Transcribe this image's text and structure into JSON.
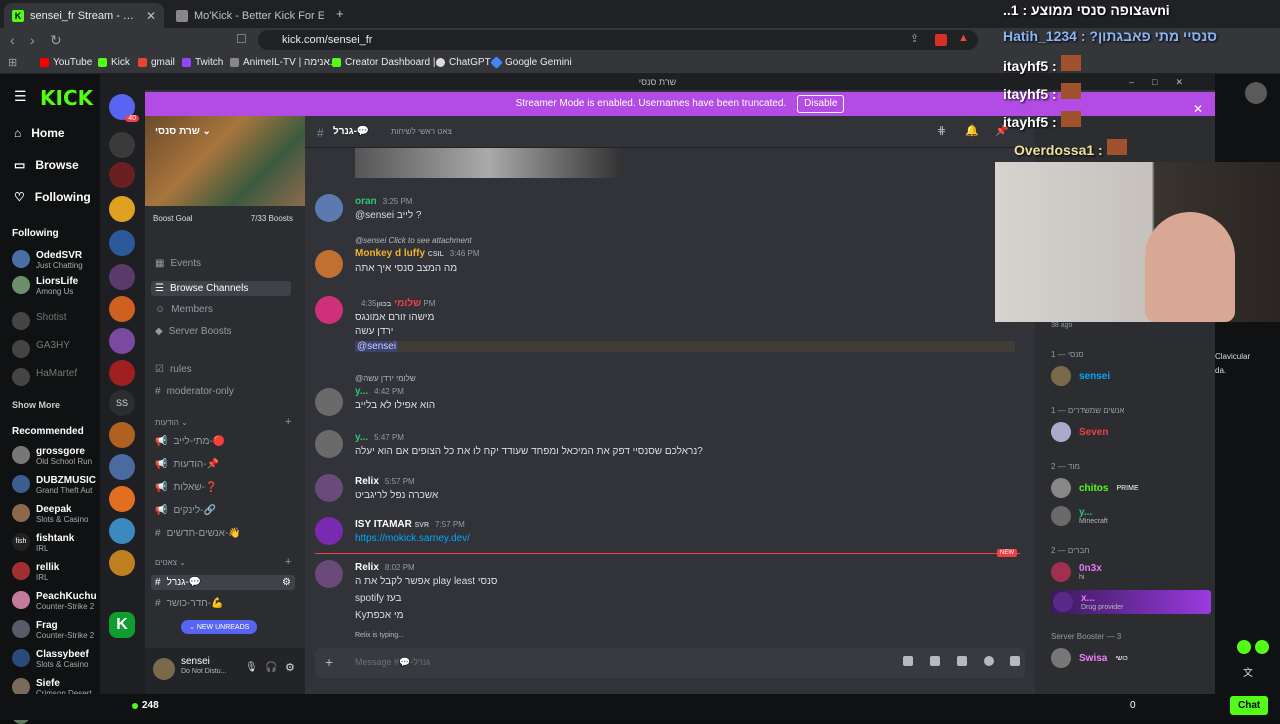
{
  "browser": {
    "tabs": [
      {
        "title": "sensei_fr Stream - Watch Live on Kick"
      },
      {
        "title": "Mo'Kick - Better Kick For Everyone -"
      }
    ],
    "url": "kick.com/sensei_fr",
    "bookmarks": [
      "YouTube",
      "Kick",
      "gmail",
      "Twitch",
      "AnimeIL-TV | אנימה...",
      "Creator Dashboard |...",
      "ChatGPT",
      "Google Gemini"
    ]
  },
  "kick": {
    "nav": [
      {
        "label": "Home"
      },
      {
        "label": "Browse"
      },
      {
        "label": "Following"
      }
    ],
    "following_title": "Following",
    "following": [
      {
        "name": "OdedSVR",
        "sub": "Just Chatting",
        "live": true
      },
      {
        "name": "LiorsLife",
        "sub": "Among Us",
        "live": true
      },
      {
        "name": "Shotist",
        "sub": "",
        "live": false
      },
      {
        "name": "GA3HY",
        "sub": "",
        "live": false
      },
      {
        "name": "HaMartef",
        "sub": "",
        "live": false
      }
    ],
    "show_more": "Show More",
    "recommended_title": "Recommended",
    "recommended": [
      {
        "name": "grossgore",
        "sub": "Old School Run"
      },
      {
        "name": "DUBZMUSIC",
        "sub": "Grand Theft Aut"
      },
      {
        "name": "Deepak",
        "sub": "Slots & Casino"
      },
      {
        "name": "fishtank",
        "sub": "IRL"
      },
      {
        "name": "rellik",
        "sub": "IRL"
      },
      {
        "name": "PeachKuchu",
        "sub": "Counter-Strike 2"
      },
      {
        "name": "Frag",
        "sub": "Counter-Strike 2"
      },
      {
        "name": "Classybeef",
        "sub": "Slots & Casino"
      },
      {
        "name": "Siefe",
        "sub": "Crimson Desert"
      },
      {
        "name": "arniev",
        "sub": ""
      }
    ],
    "viewers": "248",
    "chat_button": "Chat",
    "bottom_count": "0"
  },
  "discord": {
    "window_title": "שרת סנסי",
    "banner_text": "Streamer Mode is enabled. Usernames have been truncated.",
    "banner_button": "Disable",
    "server_name": "שרת סנסי",
    "server_badge": "40",
    "boost_goal": "Boost Goal",
    "boost_count": "7/33 Boosts",
    "channels_top": [
      {
        "label": "Events",
        "icon": "calendar-icon"
      },
      {
        "label": "Browse Channels",
        "icon": "browse-icon",
        "highlight": true
      },
      {
        "label": "Members",
        "icon": "members-icon"
      },
      {
        "label": "Server Boosts",
        "icon": "boost-icon"
      }
    ],
    "channels_mid": [
      {
        "label": "rules",
        "icon": "rules-icon"
      },
      {
        "label": "moderator-only",
        "icon": "hash-icon"
      }
    ],
    "cat_announce": "הודעות",
    "channels_announce": [
      {
        "label": "מתי-לייב-🔴"
      },
      {
        "label": "הודעות-📌"
      },
      {
        "label": "שאלות-❓"
      },
      {
        "label": "לינקים-🔗"
      },
      {
        "label": "אנשים-חדשים-👋"
      }
    ],
    "cat_chats": "צאטים",
    "channels_chats": [
      {
        "label": "גנרל-💬",
        "active": true
      },
      {
        "label": "חדר-כושר-💪"
      }
    ],
    "new_unreads": "NEW UNREADS",
    "user": {
      "name": "sensei",
      "status": "Do Not Distu..."
    },
    "channel_header": "גנרל-💬",
    "channel_topic": "צאט ראשי לשיחות",
    "search_placeholder": "Search שרת סנסי",
    "messages": [
      {
        "name": "oran",
        "time": "3:25 PM",
        "color": "#2dc770",
        "lines": [
          "@sensei לייב ?"
        ]
      },
      {
        "reply": "@sensei Click to see attachment",
        "name": "Monkey d luffy",
        "tag": "CSIL",
        "time": "3:46 PM",
        "color": "#f0b232",
        "lines": [
          "מה המצב סנסי איך אתה"
        ]
      },
      {
        "name": "שלומי",
        "tag": "בכוון",
        "time": "4:35 PM",
        "color": "#f23f43",
        "lines": [
          "מישהו זורם אמונגס",
          "ירדן עשה",
          "@sensei"
        ]
      },
      {
        "reply": "@שלומי ירדן עשה",
        "name": "y...",
        "time": "4:42 PM",
        "color": "#2dc770",
        "lines": [
          "הוא אפילו לא בלייב"
        ]
      },
      {
        "name": "y...",
        "time": "5:47 PM",
        "color": "#2dc770",
        "lines": [
          "נראלכם שסנסיי דפק את המיכאל ומפחד שעודד יקח לו את כל הצופים אם הוא יעלה?"
        ]
      },
      {
        "name": "Relix",
        "time": "5:57 PM",
        "color": "#ffffff",
        "lines": [
          "אשכרה נפל לריגביט"
        ]
      },
      {
        "name": "ISY ITAMAR",
        "tag": "SVR",
        "time": "7:57 PM",
        "color": "#ffffff",
        "lines": [
          "https://mokick.sarney.dev/"
        ]
      },
      {
        "name": "Relix",
        "time": "8:02 PM",
        "color": "#ffffff",
        "lines": [
          "אפשר לקבל את ה play least סנסי",
          "spotify בעז",
          "Kyמי אכפת"
        ]
      }
    ],
    "new_label": "NEW",
    "typing": "Relix is typing...",
    "input_placeholder": "Message #💬-גנרל",
    "member_groups": [
      {
        "title": "סנסי — 1",
        "members": [
          {
            "name": "sensei",
            "color": "#00a8fc",
            "sub": ""
          }
        ]
      },
      {
        "title": "אנשים שמשדרים — 1",
        "members": [
          {
            "name": "Seven",
            "color": "#f23f43",
            "sub": ""
          }
        ]
      },
      {
        "title": "מוד — 2",
        "members": [
          {
            "name": "chitos",
            "color": "#53fc18",
            "sub": "",
            "badge": "PRIME"
          },
          {
            "name": "y...",
            "color": "#2dc770",
            "sub": "Minecraft"
          }
        ]
      },
      {
        "title": "חברים — 2",
        "members": [
          {
            "name": "0n3x",
            "color": "#e879f9",
            "sub": "hi"
          },
          {
            "name": "x...",
            "color": "#e879f9",
            "sub": "Drug provider"
          }
        ]
      },
      {
        "title": "Server Booster — 3",
        "members": [
          {
            "name": "Swisa",
            "color": "#f47fff",
            "sub": "",
            "badge": "כושי"
          }
        ]
      }
    ],
    "member_time": "38 ago",
    "side_text": [
      "Clavicular",
      "da."
    ]
  },
  "stream_chat": [
    {
      "text": "..צופה סנסי ממוצע : 1avni"
    },
    {
      "text": "Hatih_1234 : ?סנסיי מתי פאבגתון"
    },
    {
      "text": "itayhf5 :"
    },
    {
      "text": "itayhf5 :"
    },
    {
      "text": "itayhf5 :"
    },
    {
      "text": "Overdossa1 :"
    }
  ],
  "colors": {
    "kick_green": "#53fc18",
    "discord_accent": "#b24ce5"
  }
}
